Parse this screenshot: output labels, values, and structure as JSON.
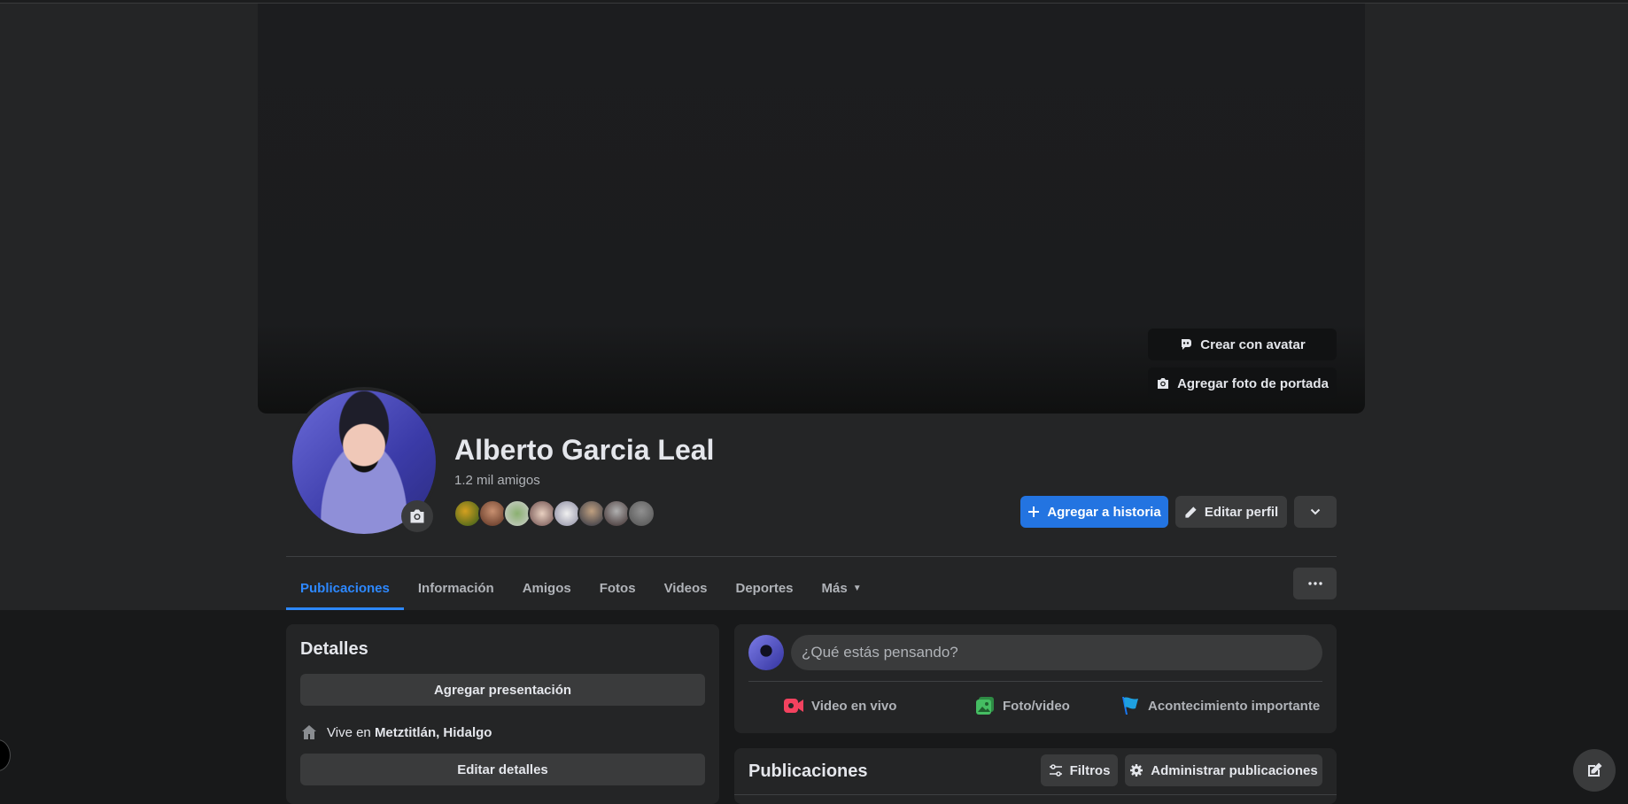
{
  "cover": {
    "create_avatar_label": "Crear con avatar",
    "add_cover_label": "Agregar foto de portada"
  },
  "profile": {
    "name": "Alberto Garcia Leal",
    "friends_count": "1.2 mil amigos",
    "add_story_label": "Agregar a historia",
    "edit_profile_label": "Editar perfil"
  },
  "tabs": [
    {
      "label": "Publicaciones"
    },
    {
      "label": "Información"
    },
    {
      "label": "Amigos"
    },
    {
      "label": "Fotos"
    },
    {
      "label": "Videos"
    },
    {
      "label": "Deportes"
    },
    {
      "label": "Más"
    }
  ],
  "details": {
    "title": "Detalles",
    "add_intro_label": "Agregar presentación",
    "lives_prefix": "Vive en",
    "lives_place": "Metztitlán, Hidalgo",
    "edit_details_label": "Editar detalles"
  },
  "composer": {
    "placeholder": "¿Qué estás pensando?",
    "live_video_label": "Video en vivo",
    "photo_video_label": "Foto/video",
    "life_event_label": "Acontecimiento importante"
  },
  "posts": {
    "title": "Publicaciones",
    "filters_label": "Filtros",
    "manage_label": "Administrar publicaciones"
  },
  "colors": {
    "accent": "#2d88ff",
    "primary_button": "#2374e1",
    "live_video": "#f3425f",
    "photo": "#45bd62",
    "event": "#1877f2"
  },
  "icons": {
    "avatar": "avatar-icon",
    "camera": "camera-icon",
    "plus": "plus-icon",
    "pencil": "pencil-icon",
    "chevron": "chevron-down-icon",
    "ellipsis": "ellipsis-icon",
    "home": "home-icon",
    "live": "live-video-icon",
    "photo": "photo-icon",
    "flag": "flag-icon",
    "filters": "filters-icon",
    "gear": "gear-icon",
    "compose": "compose-icon"
  }
}
